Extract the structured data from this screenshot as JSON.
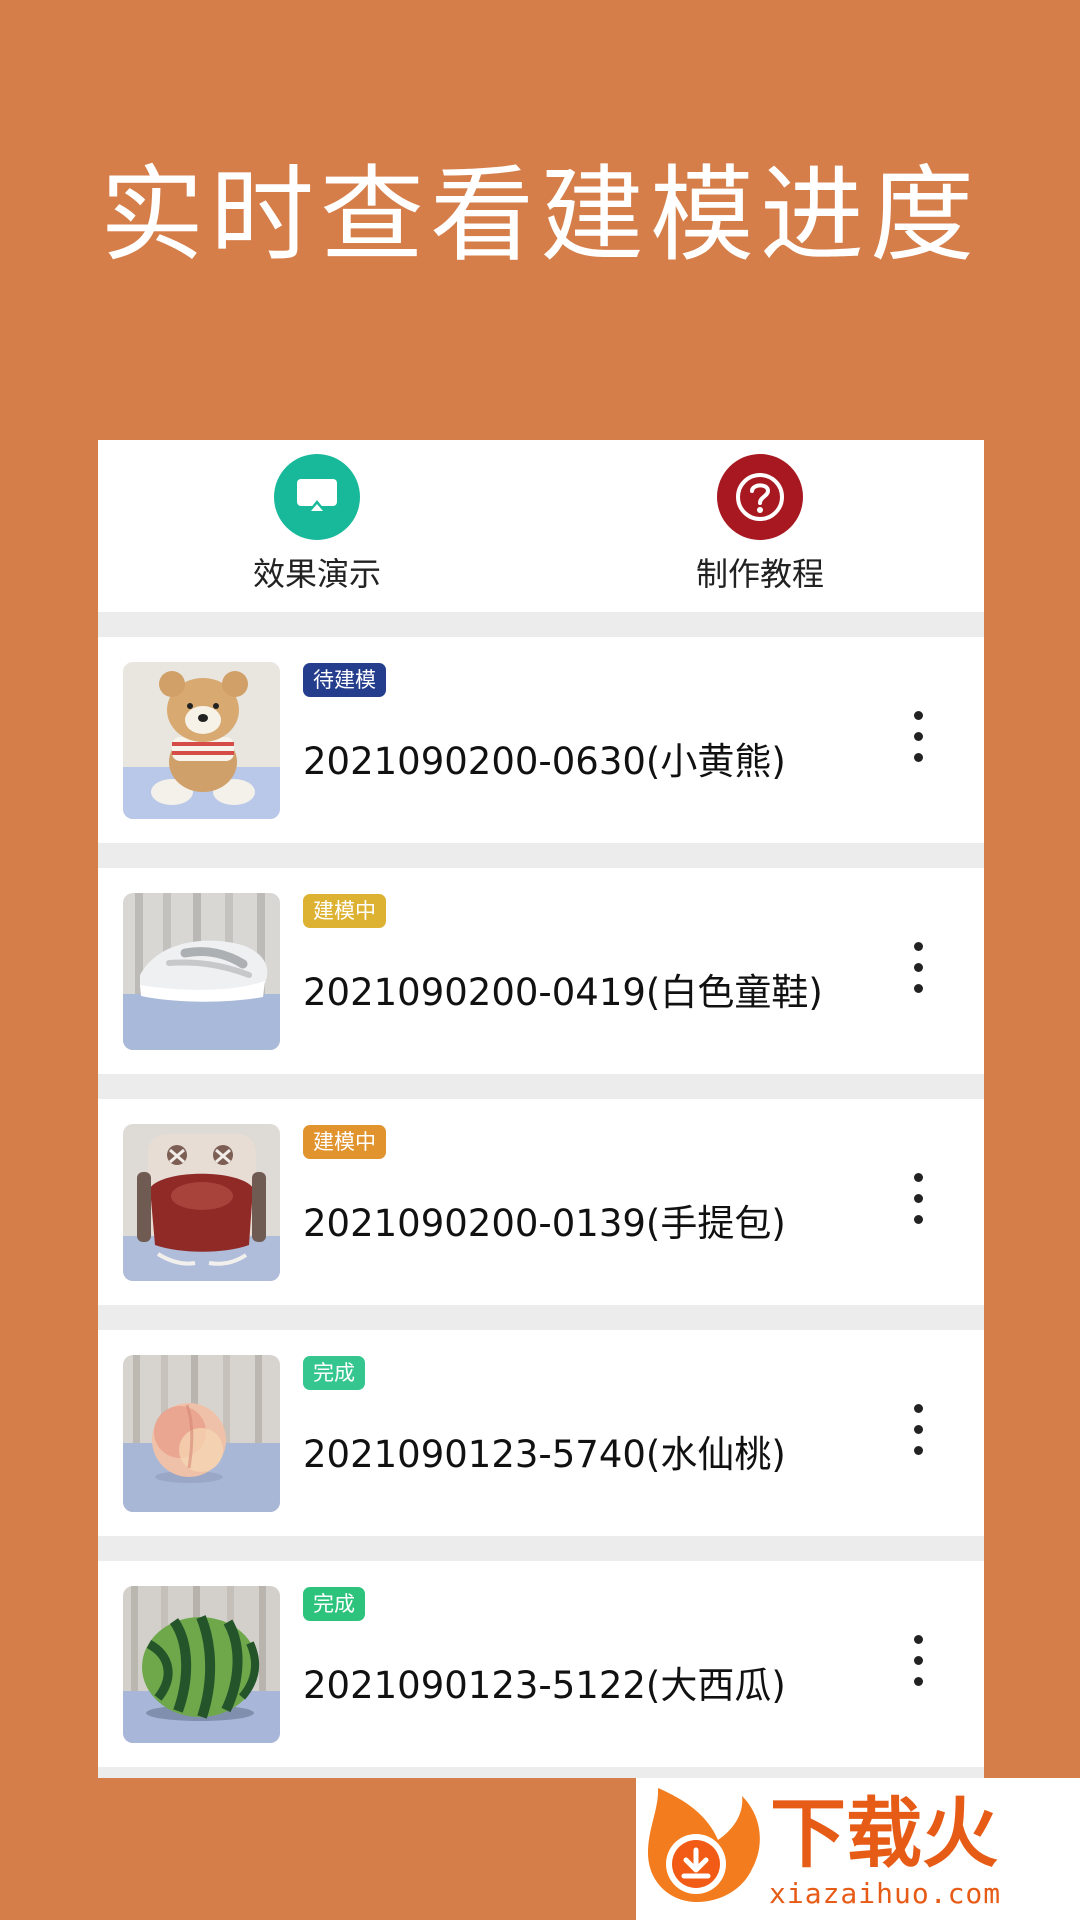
{
  "headline": "实时查看建模进度",
  "actions": [
    {
      "label": "效果演示",
      "icon": "screen-share-icon",
      "color": "#17b99a"
    },
    {
      "label": "制作教程",
      "icon": "help-circle-icon",
      "color": "#a81820"
    }
  ],
  "items": [
    {
      "status": "待建模",
      "status_color": "#253d8d",
      "title": "2021090200-0630(小黄熊)",
      "thumbnail": "teddy-bear-thumbnail"
    },
    {
      "status": "建模中",
      "status_color": "#ddb232",
      "title": "2021090200-0419(白色童鞋)",
      "thumbnail": "white-shoe-thumbnail"
    },
    {
      "status": "建模中",
      "status_color": "#e1932e",
      "title": "2021090200-0139(手提包)",
      "thumbnail": "handbag-thumbnail"
    },
    {
      "status": "完成",
      "status_color": "#35c690",
      "title": "2021090123-5740(水仙桃)",
      "thumbnail": "peach-thumbnail"
    },
    {
      "status": "完成",
      "status_color": "#2ec37d",
      "title": "2021090123-5122(大西瓜)",
      "thumbnail": "watermelon-thumbnail"
    }
  ],
  "menu_icon": "more-vertical-icon",
  "watermark": {
    "brand": "下载火",
    "url": "xiazaihuo.com",
    "color": "#e65b16"
  }
}
